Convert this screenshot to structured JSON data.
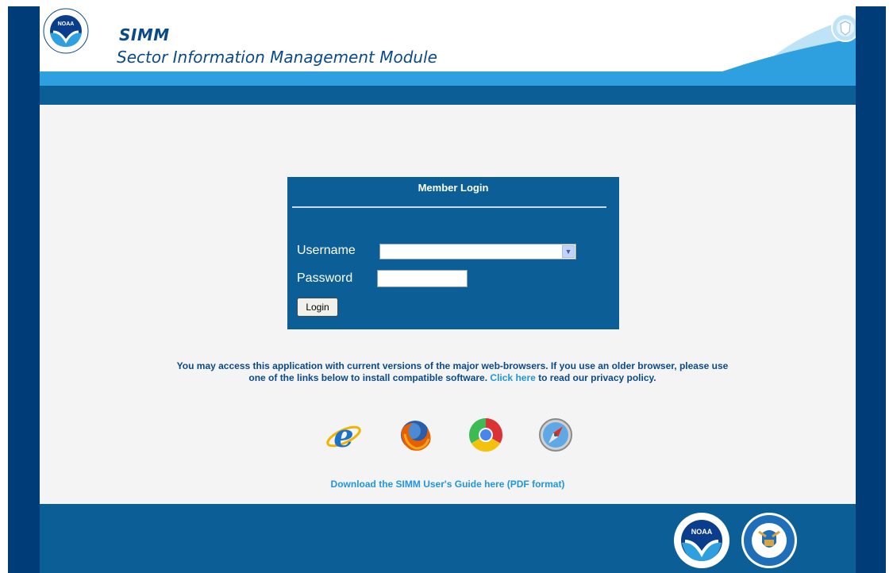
{
  "header": {
    "app_short": "SIMM",
    "app_long": "Sector Information Management Module",
    "logo_text": "NOAA"
  },
  "login": {
    "title": "Member Login",
    "username_label": "Username",
    "username_value": "",
    "password_label": "Password",
    "password_value": "",
    "button_label": "Login"
  },
  "info": {
    "text_before": "You may access this application with current versions of the major web-browsers. If you use an older browser, please use one of the links below to install compatible software.",
    "link_text": "Click here",
    "text_after": "to read our privacy policy."
  },
  "browsers": [
    {
      "name": "Internet Explorer",
      "icon": "ie-icon"
    },
    {
      "name": "Firefox",
      "icon": "firefox-icon"
    },
    {
      "name": "Chrome",
      "icon": "chrome-icon"
    },
    {
      "name": "Safari",
      "icon": "safari-icon"
    }
  ],
  "guide_link": "Download the SIMM User's Guide here (PDF format)",
  "footer": {
    "noaa_logo_text": "NOAA"
  },
  "colors": {
    "frame": "#003d78",
    "band_light": "#2ea0df",
    "band_dark": "#0b5f96",
    "text_blue": "#0b4a8a",
    "link_blue": "#2196e0"
  }
}
